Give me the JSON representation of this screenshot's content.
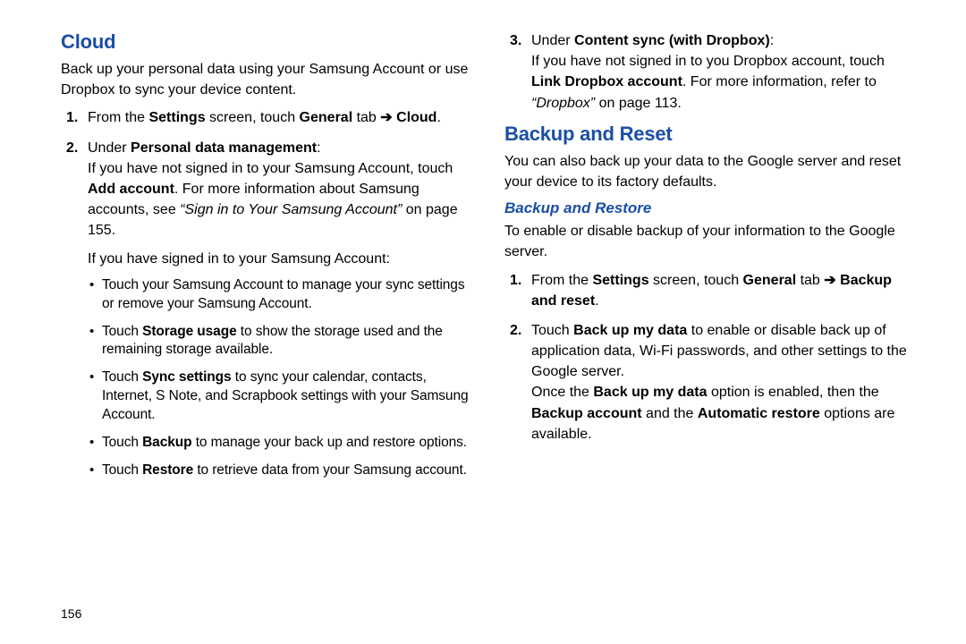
{
  "page_number": "156",
  "left": {
    "heading": "Cloud",
    "intro": "Back up your personal data using your Samsung Account or use Dropbox to sync your device content.",
    "steps": {
      "s1": {
        "pre": "From the ",
        "b1": "Settings",
        "mid1": " screen, touch ",
        "b2": "General",
        "mid2": " tab ",
        "arrow": "➔",
        "b3": " Cloud",
        "post": "."
      },
      "s2": {
        "pre": "Under ",
        "b1": "Personal data management",
        "post": ":",
        "para1_pre": "If you have not signed in to your Samsung Account, touch ",
        "para1_b": "Add account",
        "para1_mid": ". For more information about Samsung accounts, see ",
        "para1_i": "“Sign in to Your Samsung Account”",
        "para1_post": " on page 155.",
        "para2": "If you have signed in to your Samsung Account:",
        "bullets": {
          "b1": "Touch your Samsung Account to manage your sync settings or remove your Samsung Account.",
          "b2_pre": "Touch ",
          "b2_b": "Storage usage",
          "b2_post": " to show the storage used and the remaining storage available.",
          "b3_pre": "Touch ",
          "b3_b": "Sync settings",
          "b3_post": " to sync your calendar, contacts, Internet, S Note, and Scrapbook settings with your Samsung Account.",
          "b4_pre": "Touch ",
          "b4_b": "Backup",
          "b4_post": " to manage your back up and restore options.",
          "b5_pre": "Touch ",
          "b5_b": "Restore",
          "b5_post": " to retrieve data from your Samsung account."
        }
      }
    }
  },
  "right": {
    "step3": {
      "pre": "Under ",
      "b1": "Content sync (with Dropbox)",
      "post": ":",
      "para1_pre": "If you have not signed in to you Dropbox account, touch ",
      "para1_b": "Link Dropbox account",
      "para1_mid": ". For more information, refer to ",
      "para1_i": "“Dropbox”",
      "para1_post": " on page 113."
    },
    "heading": "Backup and Reset",
    "intro": "You can also back up your data to the Google server and reset your device to its factory defaults.",
    "sub": "Backup and Restore",
    "sub_intro": "To enable or disable backup of your information to the Google server.",
    "steps": {
      "s1": {
        "pre": "From the ",
        "b1": "Settings",
        "mid1": " screen, touch ",
        "b2": "General",
        "mid2": " tab ",
        "arrow": "➔",
        "b3": " Backup and reset",
        "post": "."
      },
      "s2": {
        "pre": "Touch ",
        "b1": "Back up my data",
        "post": " to enable or disable back up of application data, Wi-Fi passwords, and other settings to the Google server.",
        "para2_pre": "Once the ",
        "para2_b1": "Back up my data",
        "para2_mid1": " option is enabled, then the ",
        "para2_b2": "Backup account",
        "para2_mid2": " and the ",
        "para2_b3": "Automatic restore",
        "para2_post": " options are available."
      }
    }
  }
}
